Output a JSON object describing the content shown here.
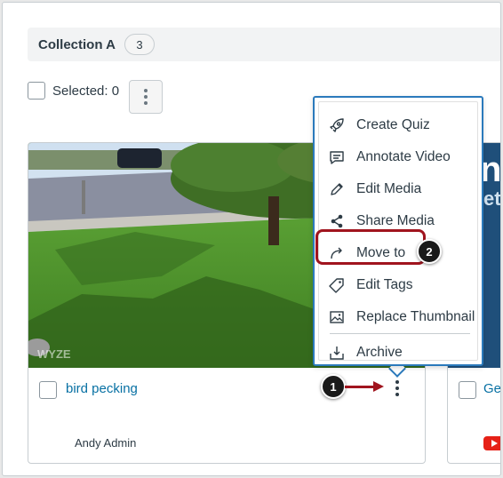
{
  "collection": {
    "title": "Collection A",
    "count": "3"
  },
  "selection": {
    "label": "Selected: 0"
  },
  "card": {
    "title": "bird pecking",
    "owner": "Andy Admin",
    "watermark": "WYZE"
  },
  "card2": {
    "title": "Ge",
    "thumb_text": "n",
    "thumb_sub": "et"
  },
  "menu": {
    "items": [
      {
        "label": "Create Quiz",
        "icon": "rocket-icon"
      },
      {
        "label": "Annotate Video",
        "icon": "comment-icon"
      },
      {
        "label": "Edit Media",
        "icon": "pencil-icon"
      },
      {
        "label": "Share Media",
        "icon": "share-icon"
      },
      {
        "label": "Move to",
        "icon": "move-arrow-icon"
      },
      {
        "label": "Edit Tags",
        "icon": "tag-icon"
      },
      {
        "label": "Replace Thumbnail",
        "icon": "image-icon"
      },
      {
        "label": "Archive",
        "icon": "archive-icon"
      }
    ]
  },
  "callouts": {
    "one": "1",
    "two": "2"
  },
  "colors": {
    "link": "#0770a3",
    "menu_border": "#2b7abc",
    "callout_red": "#a0141e"
  }
}
